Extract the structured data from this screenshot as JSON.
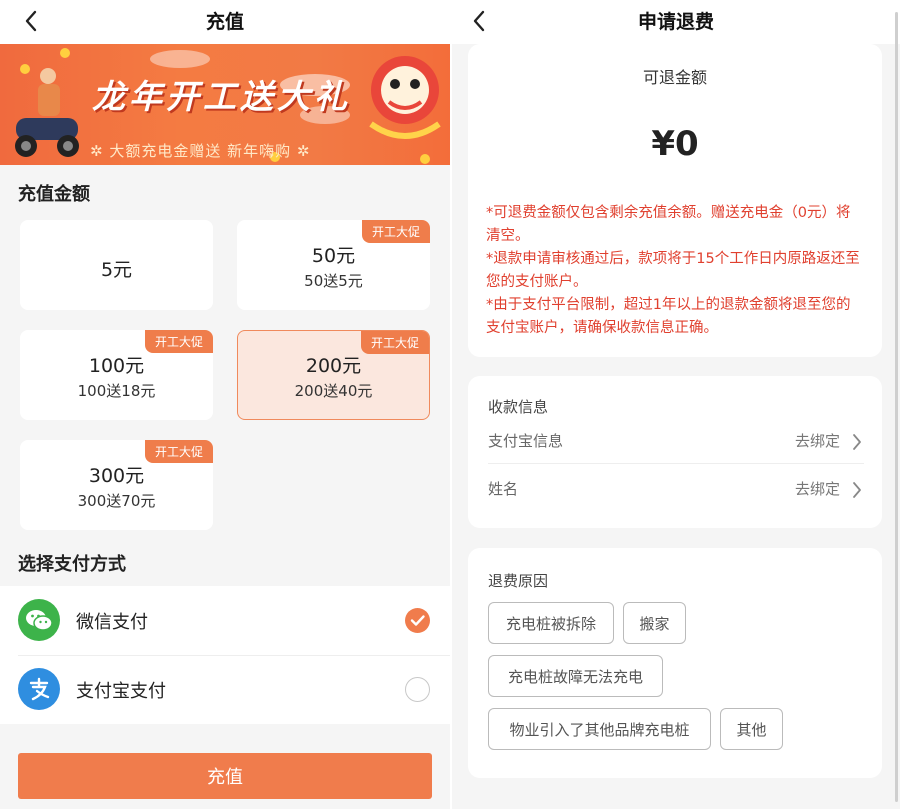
{
  "left": {
    "nav": {
      "title": "充值"
    },
    "banner": {
      "headline": "龙年开工送大礼",
      "subline": "✲ 大额充电金赠送 新年嗨购 ✲"
    },
    "amount_section": {
      "title": "充值金额"
    },
    "amounts": [
      {
        "amount": "5元",
        "bonus": "",
        "promo": "",
        "selected": false
      },
      {
        "amount": "50元",
        "bonus": "50送5元",
        "promo": "开工大促",
        "selected": false
      },
      {
        "amount": "100元",
        "bonus": "100送18元",
        "promo": "开工大促",
        "selected": false
      },
      {
        "amount": "200元",
        "bonus": "200送40元",
        "promo": "开工大促",
        "selected": true
      },
      {
        "amount": "300元",
        "bonus": "300送70元",
        "promo": "开工大促",
        "selected": false
      }
    ],
    "payment_section": {
      "title": "选择支付方式"
    },
    "payments": [
      {
        "label": "微信支付",
        "icon": "wechat-icon",
        "color": "#3db34a",
        "checked": true
      },
      {
        "label": "支付宝支付",
        "icon": "alipay-icon",
        "color": "#2f8ee0",
        "checked": false
      }
    ],
    "submit_label": "充值"
  },
  "right": {
    "nav": {
      "title": "申请退费"
    },
    "refund": {
      "label": "可退金额",
      "amount": "¥0",
      "notices": [
        "*可退费金额仅包含剩余充值余额。赠送充电金（0元）将清空。",
        "*退款申请审核通过后，款项将于15个工作日内原路返还至您的支付账户。",
        "*由于支付平台限制，超过1年以上的退款金额将退至您的支付宝账户，请确保收款信息正确。"
      ]
    },
    "collect": {
      "title": "收款信息",
      "rows": [
        {
          "key": "支付宝信息",
          "value": "去绑定"
        },
        {
          "key": "姓名",
          "value": "去绑定"
        }
      ]
    },
    "reasons": {
      "title": "退费原因",
      "tags": [
        "充电桩被拆除",
        "搬家",
        "充电桩故障无法充电",
        "物业引入了其他品牌充电桩",
        "其他"
      ]
    }
  },
  "colors": {
    "accent": "#f07c4c",
    "notice": "#e0402f",
    "wechat": "#3db34a",
    "alipay": "#2f8ee0"
  }
}
